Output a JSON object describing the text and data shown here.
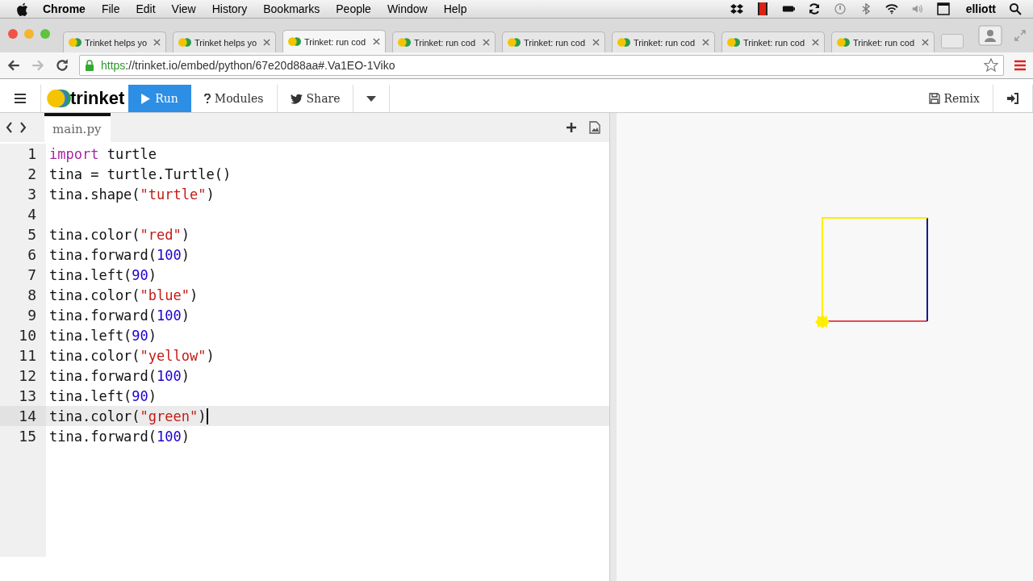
{
  "menubar": {
    "app": "Chrome",
    "menus": [
      "File",
      "Edit",
      "View",
      "History",
      "Bookmarks",
      "People",
      "Window",
      "Help"
    ],
    "user": "elliott"
  },
  "tabs": [
    {
      "title": "Trinket helps yo",
      "selected": false
    },
    {
      "title": "Trinket helps yo",
      "selected": false
    },
    {
      "title": "Trinket: run cod",
      "selected": true
    },
    {
      "title": "Trinket: run cod",
      "selected": false
    },
    {
      "title": "Trinket: run cod",
      "selected": false
    },
    {
      "title": "Trinket: run cod",
      "selected": false
    },
    {
      "title": "Trinket: run cod",
      "selected": false
    },
    {
      "title": "Trinket: run cod",
      "selected": false
    }
  ],
  "address": {
    "scheme": "https",
    "rest": "://trinket.io/embed/python/67e20d88aa#.Va1EO-1Viko"
  },
  "toolbar": {
    "logo": "trinket",
    "run": "Run",
    "modules": "Modules",
    "share": "Share",
    "remix": "Remix"
  },
  "editor": {
    "file_tab": "main.py",
    "lines": [
      {
        "number": "1",
        "selected": false,
        "tokens": [
          {
            "kind": "kw",
            "text": "import"
          },
          {
            "kind": "plain",
            "text": " turtle"
          }
        ]
      },
      {
        "number": "2",
        "selected": false,
        "tokens": [
          {
            "kind": "plain",
            "text": "tina = turtle.Turtle()"
          }
        ]
      },
      {
        "number": "3",
        "selected": false,
        "tokens": [
          {
            "kind": "plain",
            "text": "tina.shape("
          },
          {
            "kind": "str",
            "text": "\"turtle\""
          },
          {
            "kind": "plain",
            "text": ")"
          }
        ]
      },
      {
        "number": "4",
        "selected": false
      },
      {
        "number": "5",
        "selected": false,
        "tokens": [
          {
            "kind": "plain",
            "text": "tina.color("
          },
          {
            "kind": "str",
            "text": "\"red\""
          },
          {
            "kind": "plain",
            "text": ")"
          }
        ]
      },
      {
        "number": "6",
        "selected": false,
        "tokens": [
          {
            "kind": "plain",
            "text": "tina.forward("
          },
          {
            "kind": "num",
            "text": "100"
          },
          {
            "kind": "plain",
            "text": ")"
          }
        ]
      },
      {
        "number": "7",
        "selected": false,
        "tokens": [
          {
            "kind": "plain",
            "text": "tina.left("
          },
          {
            "kind": "num",
            "text": "90"
          },
          {
            "kind": "plain",
            "text": ")"
          }
        ]
      },
      {
        "number": "8",
        "selected": false,
        "tokens": [
          {
            "kind": "plain",
            "text": "tina.color("
          },
          {
            "kind": "str",
            "text": "\"blue\""
          },
          {
            "kind": "plain",
            "text": ")"
          }
        ]
      },
      {
        "number": "9",
        "selected": false,
        "tokens": [
          {
            "kind": "plain",
            "text": "tina.forward("
          },
          {
            "kind": "num",
            "text": "100"
          },
          {
            "kind": "plain",
            "text": ")"
          }
        ]
      },
      {
        "number": "10",
        "selected": false,
        "tokens": [
          {
            "kind": "plain",
            "text": "tina.left("
          },
          {
            "kind": "num",
            "text": "90"
          },
          {
            "kind": "plain",
            "text": ")"
          }
        ]
      },
      {
        "number": "11",
        "selected": false,
        "tokens": [
          {
            "kind": "plain",
            "text": "tina.color("
          },
          {
            "kind": "str",
            "text": "\"yellow\""
          },
          {
            "kind": "plain",
            "text": ")"
          }
        ]
      },
      {
        "number": "12",
        "selected": false,
        "tokens": [
          {
            "kind": "plain",
            "text": "tina.forward("
          },
          {
            "kind": "num",
            "text": "100"
          },
          {
            "kind": "plain",
            "text": ")"
          }
        ]
      },
      {
        "number": "13",
        "selected": false,
        "tokens": [
          {
            "kind": "plain",
            "text": "tina.left("
          },
          {
            "kind": "num",
            "text": "90"
          },
          {
            "kind": "plain",
            "text": ")"
          }
        ]
      },
      {
        "number": "14",
        "selected": true,
        "tokens": [
          {
            "kind": "plain",
            "text": "tina.color("
          },
          {
            "kind": "str",
            "text": "\"green\""
          },
          {
            "kind": "plain",
            "text": ")"
          }
        ]
      },
      {
        "number": "15",
        "selected": false,
        "tokens": [
          {
            "kind": "plain",
            "text": "tina.forward("
          },
          {
            "kind": "num",
            "text": "100"
          },
          {
            "kind": "plain",
            "text": ")"
          }
        ]
      }
    ]
  }
}
